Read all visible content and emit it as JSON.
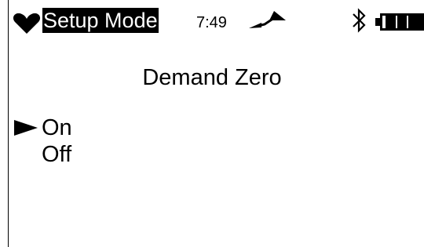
{
  "status_bar": {
    "mode_label": "Setup Mode",
    "time": "7:49",
    "icons": [
      "heart-icon",
      "signal-icon",
      "bluetooth-icon",
      "battery-icon"
    ]
  },
  "title": "Demand Zero",
  "options": [
    {
      "label": "On",
      "selected": true
    },
    {
      "label": "Off",
      "selected": false
    }
  ],
  "colors": {
    "foreground": "#000000",
    "background": "#ffffff"
  }
}
